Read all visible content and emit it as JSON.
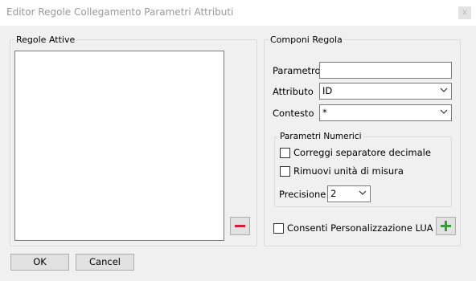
{
  "window": {
    "title": "Editor Regole Collegamento Parametri Attributi",
    "close_glyph": "x"
  },
  "regole_attive": {
    "legend": "Regole Attive",
    "remove_icon": "minus-icon",
    "remove_color": "#d21f3c"
  },
  "componi_regola": {
    "legend": "Componi Regola",
    "parametro": {
      "label": "Parametro",
      "value": ""
    },
    "attributo": {
      "label": "Attributo",
      "value": "ID"
    },
    "contesto": {
      "label": "Contesto",
      "value": "*"
    },
    "parametri_numerici": {
      "legend": "Parametri Numerici",
      "correggi": {
        "label": "Correggi separatore decimale",
        "checked": false
      },
      "rimuovi": {
        "label": "Rimuovi unità di misura",
        "checked": false
      },
      "precisione": {
        "label": "Precisione",
        "value": "2"
      }
    },
    "lua": {
      "label": "Consenti Personalizzazione LUA",
      "checked": false
    },
    "add_icon": "plus-icon",
    "add_color": "#3a9a3a"
  },
  "buttons": {
    "ok": "OK",
    "cancel": "Cancel"
  }
}
